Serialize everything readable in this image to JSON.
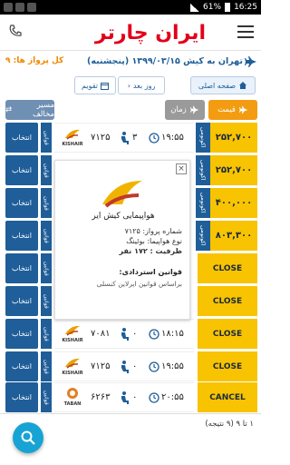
{
  "statusbar": {
    "battery": "61%",
    "time": "16:25"
  },
  "header": {
    "logo_text": "ایران چارتر"
  },
  "route": {
    "title": "تهران به کیش ۱۳۹۹/۰۳/۱۵ (پنجشنبه)",
    "flight_count": "کل پرواز ها: ۹"
  },
  "nav": {
    "home": "صفحه اصلی",
    "prev_day": "روز بعد",
    "calendar": "تقویم"
  },
  "sort": {
    "price": "قیمت",
    "time": "زمان",
    "airline": "مسیر مخالف"
  },
  "rows": [
    {
      "select": "انتخاب",
      "airline_code": "KISHAIR",
      "flight": "۷۱۲۵",
      "seats": "۳",
      "time": "۱۹:۵۵",
      "class": "اکونومی",
      "price": "۲۵۲,۷۰۰",
      "strip": "قوانین"
    },
    {
      "select": "انتخاب",
      "class": "اکونومی",
      "price": "۲۵۲,۷۰۰",
      "strip": "قوانین"
    },
    {
      "select": "انتخاب",
      "class": "اکونومی",
      "price": "۴۰۰,۰۰۰",
      "strip": "قوانین"
    },
    {
      "select": "انتخاب",
      "class": "اکونومی",
      "price": "۸۰۳,۳۰۰",
      "strip": "قوانین"
    },
    {
      "select": "انتخاب",
      "status": "CLOSE",
      "strip": "قوانین"
    },
    {
      "select": "انتخاب",
      "status": "CLOSE",
      "strip": "قوانین"
    },
    {
      "select": "انتخاب",
      "airline_code": "KISHAIR",
      "flight": "۷۰۸۱",
      "seats": "۰",
      "time": "۱۸:۱۵",
      "status": "CLOSE",
      "strip": "قوانین"
    },
    {
      "select": "انتخاب",
      "airline_code": "KISHAIR",
      "flight": "۷۱۲۵",
      "seats": "۰",
      "time": "۱۹:۵۵",
      "status": "CLOSE",
      "strip": "قوانین"
    },
    {
      "select": "انتخاب",
      "airline_code": "TABAN",
      "flight": "۶۲۶۳",
      "seats": "۰",
      "time": "۲۰:۵۵",
      "status": "CANCEL",
      "strip": "قوانین"
    }
  ],
  "popup": {
    "airline_name": "هواپیمایی کیش ایر",
    "flight_number": "شماره پرواز: ۷۱۲۵",
    "aircraft": "نوع هواپیما: بوئینگ",
    "capacity": "ظرفیت : ۱۷۲ نفر",
    "refund_title": "قوانین استردادی:",
    "refund_text": "براساس قوانین ایرلاین کنسلی",
    "close": "×"
  },
  "footer": {
    "result_count": "۱ تا ۹ (۹ نتیجه)"
  },
  "colors": {
    "primary": "#1f5e99",
    "price": "#f8c300",
    "accent_orange": "#f39c12",
    "logo_red": "#e2001a",
    "fab": "#17a4d4"
  },
  "icons": [
    "phone-icon",
    "menu-icon",
    "plane-icon",
    "home-icon",
    "calendar-icon",
    "clock-icon",
    "seat-icon",
    "search-icon",
    "close-icon"
  ]
}
